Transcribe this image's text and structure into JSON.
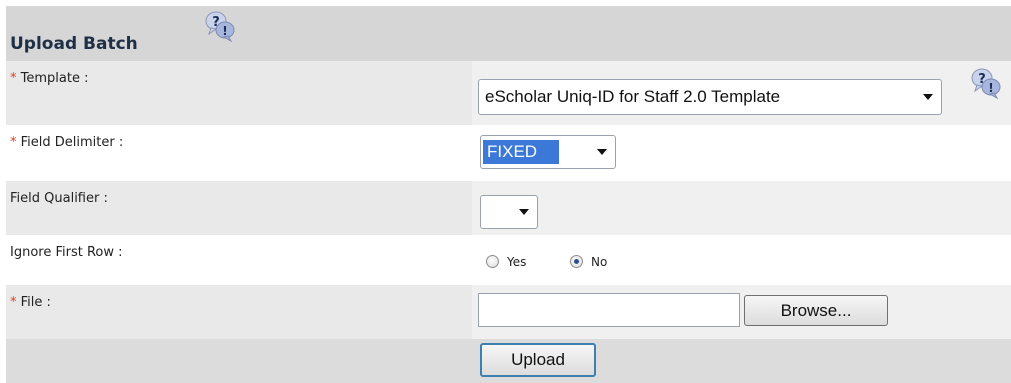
{
  "form": {
    "title": "Upload Batch",
    "required_marker": "*",
    "fields": {
      "template": {
        "label": "Template :",
        "value": "eScholar Uniq-ID for Staff 2.0 Template"
      },
      "field_delimiter": {
        "label": "Field Delimiter :",
        "value": "FIXED"
      },
      "field_qualifier": {
        "label": "Field Qualifier :",
        "value": ""
      },
      "ignore_first_row": {
        "label": "Ignore First Row :",
        "option_yes": "Yes",
        "option_no": "No",
        "selected": "No"
      },
      "file": {
        "label": "File :",
        "value": "",
        "browse_label": "Browse..."
      }
    },
    "upload_label": "Upload"
  },
  "icons": {
    "help": "help-question-bubble-icon"
  },
  "colors": {
    "header_bg": "#d6d6d6",
    "title_text": "#1f2f46",
    "required_star": "#e0401f",
    "selection_highlight": "#3b78d8"
  }
}
